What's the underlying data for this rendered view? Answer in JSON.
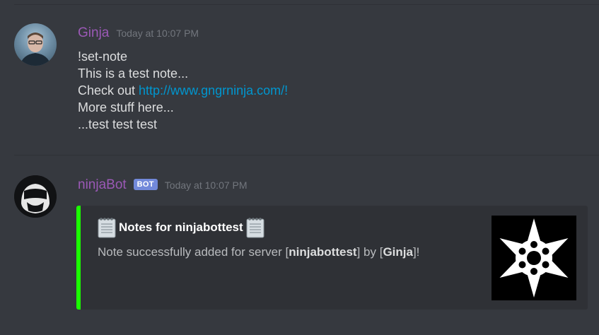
{
  "messages": [
    {
      "username": "Ginja",
      "timestamp": "Today at 10:07 PM",
      "lines": [
        "!set-note",
        "This is a test note...",
        "Check out ",
        "More stuff here...",
        "...test test test"
      ],
      "link": "http://www.gngrninja.com/!"
    },
    {
      "username": "ninjaBot",
      "tag": "BOT",
      "timestamp": "Today at 10:07 PM",
      "embed": {
        "title": "Notes for ninjabottest",
        "desc_prefix": "Note successfully added for server [",
        "server": "ninjabottest",
        "desc_middle": "] by [",
        "author": "Ginja",
        "desc_suffix": "]!",
        "accent_color": "#1aff00"
      }
    }
  ],
  "icons": {
    "note": "spiral-notepad-icon",
    "thumbnail": "shuriken-icon"
  },
  "colors": {
    "background": "#36393f",
    "username": "#9b59b6",
    "link": "#0096cf",
    "bot_tag": "#7289da"
  }
}
